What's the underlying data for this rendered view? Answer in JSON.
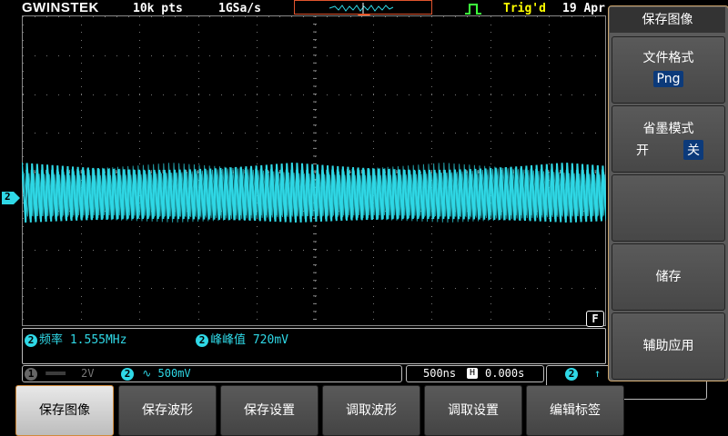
{
  "status_bar": {
    "logo": "GWINSTEK",
    "record_length": "10k pts",
    "sample_rate": "1GSa/s",
    "trigger_state": "Trig'd",
    "date": "19 Apr"
  },
  "waveform": {
    "channel_marker": "2"
  },
  "measurements": [
    {
      "channel": "2",
      "label": "频率",
      "value": "1.555MHz"
    },
    {
      "channel": "2",
      "label": "峰峰值",
      "value": "720mV"
    }
  ],
  "channel_bar": {
    "ch1_number": "1",
    "ch1_scale": "2V",
    "ch2_number": "2",
    "ch2_coupling_symbol": "∿",
    "ch2_scale": "500mV",
    "timebase": "500ns",
    "horiz_icon": "H",
    "horiz_position": "0.000s",
    "trigger_channel": "2",
    "trigger_edge_symbol": "↑",
    "f_badge": "F"
  },
  "side_menu": {
    "title": "保存图像",
    "file_format_label": "文件格式",
    "file_format_value": "Png",
    "ink_saver_label": "省墨模式",
    "ink_saver_on": "开",
    "ink_saver_off": "关",
    "save_label": "储存",
    "assist_label": "辅助应用"
  },
  "soft_keys": [
    "保存图像",
    "保存波形",
    "保存设置",
    "调取波形",
    "调取设置",
    "编辑标签"
  ],
  "colors": {
    "ch2": "#2fd8e6",
    "trig_state": "#ffff00",
    "menu_border": "#c9a26a",
    "trigger_marker": "#ff5a1e"
  }
}
